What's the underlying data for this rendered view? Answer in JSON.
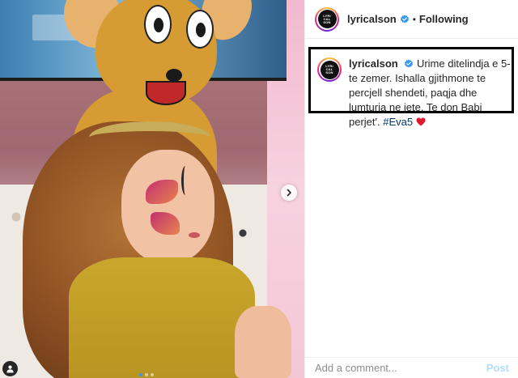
{
  "post": {
    "username": "lyricalson",
    "avatar_logo_text": "LYRICAL SON",
    "follow_status": "Following",
    "separator": "•",
    "caption": {
      "username": "lyricalson",
      "text": "Urime ditelindja e 5-te zemer. Ishalla gjithmone te percjell shendeti, paqja dhe lumturia ne jete. Te don Babi perjet'.",
      "hashtag": "#Eva5",
      "emoji": "red-heart-icon"
    },
    "carousel": {
      "dot_count": 3,
      "active_index": 0,
      "next_icon": "chevron-right-icon",
      "tag_icon": "user-tag-icon"
    }
  },
  "comment": {
    "placeholder": "Add a comment...",
    "post_label": "Post"
  },
  "colors": {
    "verified": "#3897f0",
    "hashtag": "#00376b",
    "post_disabled": "#b3dbff",
    "caption_border": "#000000"
  }
}
